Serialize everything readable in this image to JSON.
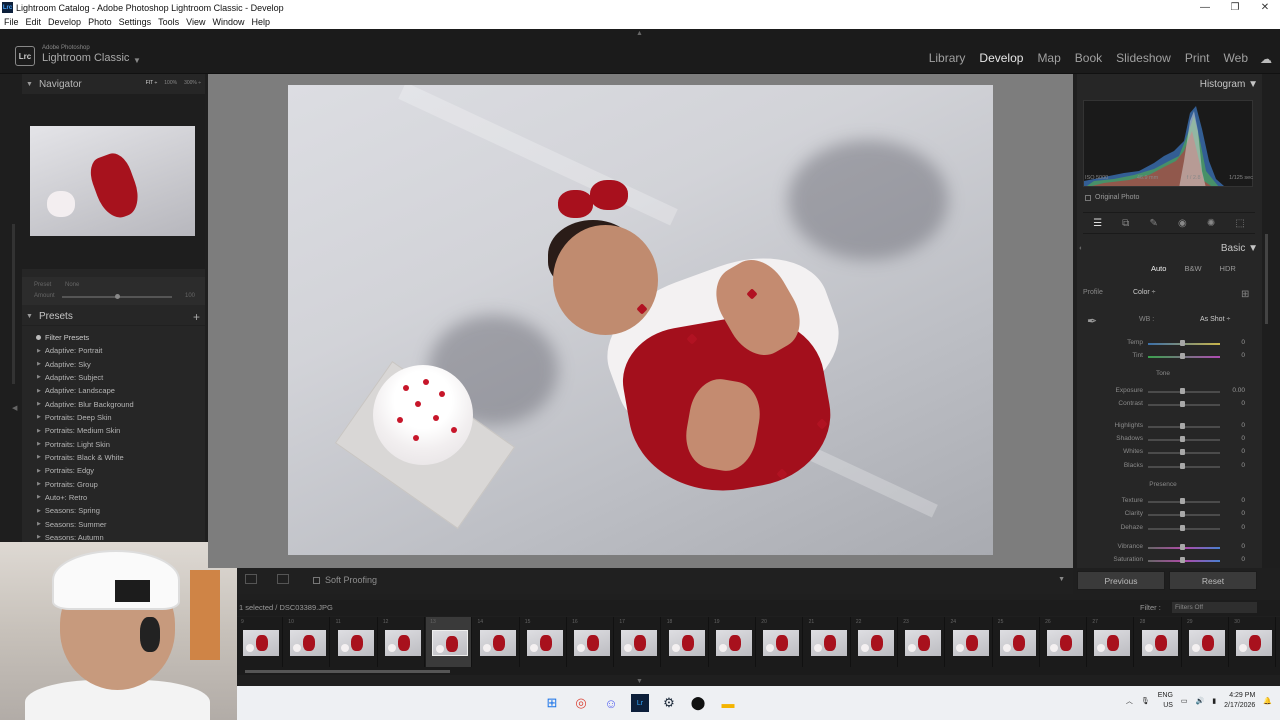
{
  "window": {
    "title": "Lightroom Catalog - Adobe Photoshop Lightroom Classic - Develop",
    "app_icon": "Lrc",
    "controls": [
      "—",
      "❐",
      "✕"
    ]
  },
  "menu": [
    "File",
    "Edit",
    "Develop",
    "Photo",
    "Settings",
    "Tools",
    "View",
    "Window",
    "Help"
  ],
  "brand": {
    "logo": "Lrc",
    "small": "Adobe Photoshop",
    "main": "Lightroom Classic"
  },
  "modules": [
    "Library",
    "Develop",
    "Map",
    "Book",
    "Slideshow",
    "Print",
    "Web"
  ],
  "navigator": {
    "title": "Navigator",
    "zoom": [
      "FIT ÷",
      "100%",
      "300% ÷"
    ]
  },
  "preset_amount": {
    "preset_label": "Preset",
    "preset_value": "None",
    "amount_label": "Amount",
    "amount_value": "100"
  },
  "presets": {
    "title": "Presets",
    "filter_label": "Filter Presets",
    "items": [
      "Adaptive: Portrait",
      "Adaptive: Sky",
      "Adaptive: Subject",
      "Adaptive: Landscape",
      "Adaptive: Blur Background",
      "Portraits: Deep Skin",
      "Portraits: Medium Skin",
      "Portraits: Light Skin",
      "Portraits: Black & White",
      "Portraits: Edgy",
      "Portraits: Group",
      "Auto+: Retro",
      "Seasons: Spring",
      "Seasons: Summer",
      "Seasons: Autumn"
    ]
  },
  "toolbar": {
    "soft_proofing": "Soft Proofing"
  },
  "histogram": {
    "title": "Histogram",
    "iso": "ISO 5000",
    "focal": "46.9 mm",
    "aperture": "f / 2.8",
    "shutter": "1/125 sec",
    "original_photo": "Original Photo"
  },
  "basic": {
    "title": "Basic",
    "modes": [
      "Auto",
      "B&W",
      "HDR"
    ],
    "profile_label": "Profile",
    "profile_value": "Color ÷",
    "wb_label": "WB :",
    "wb_value": "As Shot ÷",
    "tone_label": "Tone",
    "presence_label": "Presence",
    "sliders": [
      {
        "label": "Temp",
        "value": "0"
      },
      {
        "label": "Tint",
        "value": "0"
      },
      {
        "label": "Exposure",
        "value": "0.00"
      },
      {
        "label": "Contrast",
        "value": "0"
      },
      {
        "label": "Highlights",
        "value": "0"
      },
      {
        "label": "Shadows",
        "value": "0"
      },
      {
        "label": "Whites",
        "value": "0"
      },
      {
        "label": "Blacks",
        "value": "0"
      },
      {
        "label": "Texture",
        "value": "0"
      },
      {
        "label": "Clarity",
        "value": "0"
      },
      {
        "label": "Dehaze",
        "value": "0"
      },
      {
        "label": "Vibrance",
        "value": "0"
      },
      {
        "label": "Saturation",
        "value": "0"
      }
    ]
  },
  "buttons": {
    "previous": "Previous",
    "reset": "Reset"
  },
  "filmstrip_bar": {
    "selected_text": "1 selected / DSC03389.JPG",
    "filter_label": "Filter :",
    "filter_value": "Filters Off"
  },
  "filmstrip": {
    "numbers": [
      "9",
      "10",
      "11",
      "12",
      "13",
      "14",
      "15",
      "16",
      "17",
      "18",
      "19",
      "20",
      "21",
      "22",
      "23",
      "24",
      "25",
      "26",
      "27",
      "28",
      "29",
      "30"
    ],
    "selected_index": 4
  },
  "taskbar": {
    "lang": "ENG",
    "region": "US",
    "time": "4:29 PM",
    "date": "2/17/2026"
  }
}
